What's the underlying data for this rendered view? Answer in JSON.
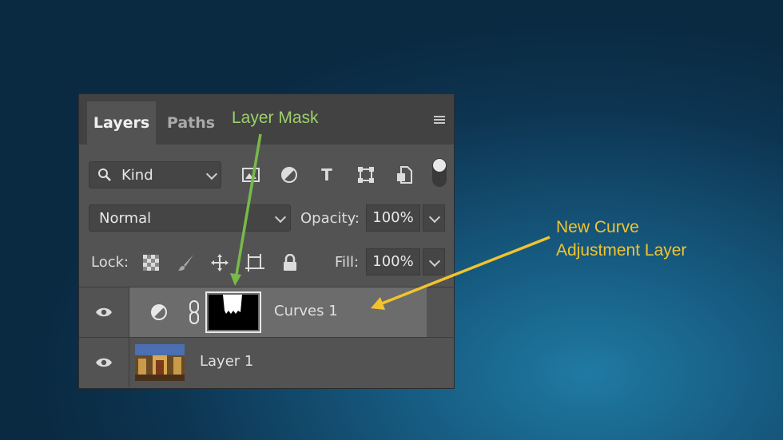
{
  "panel": {
    "tabs": [
      {
        "label": "Layers",
        "active": true
      },
      {
        "label": "Paths",
        "active": false
      }
    ],
    "filter": {
      "kind_label": "Kind",
      "icons": [
        "image-filter-icon",
        "adjustment-filter-icon",
        "type-filter-icon",
        "shape-filter-icon",
        "smart-object-filter-icon"
      ]
    },
    "blend_mode": "Normal",
    "opacity_label": "Opacity:",
    "opacity_value": "100%",
    "lock_label": "Lock:",
    "lock_icons": [
      "lock-transparent-icon",
      "lock-image-icon",
      "lock-position-icon",
      "lock-artboard-icon",
      "lock-all-icon"
    ],
    "fill_label": "Fill:",
    "fill_value": "100%",
    "layers": [
      {
        "name": "Curves 1",
        "selected": true,
        "visible": true
      },
      {
        "name": "Layer 1",
        "selected": false,
        "visible": true
      }
    ]
  },
  "annotations": {
    "layer_mask": "Layer Mask",
    "new_curve_line1": "New Curve",
    "new_curve_line2": "Adjustment Layer"
  },
  "colors": {
    "green_annotation": "#9dd06a",
    "yellow_annotation": "#f2c32e",
    "panel_bg": "#535353",
    "selected_row": "#6c6c6c"
  }
}
